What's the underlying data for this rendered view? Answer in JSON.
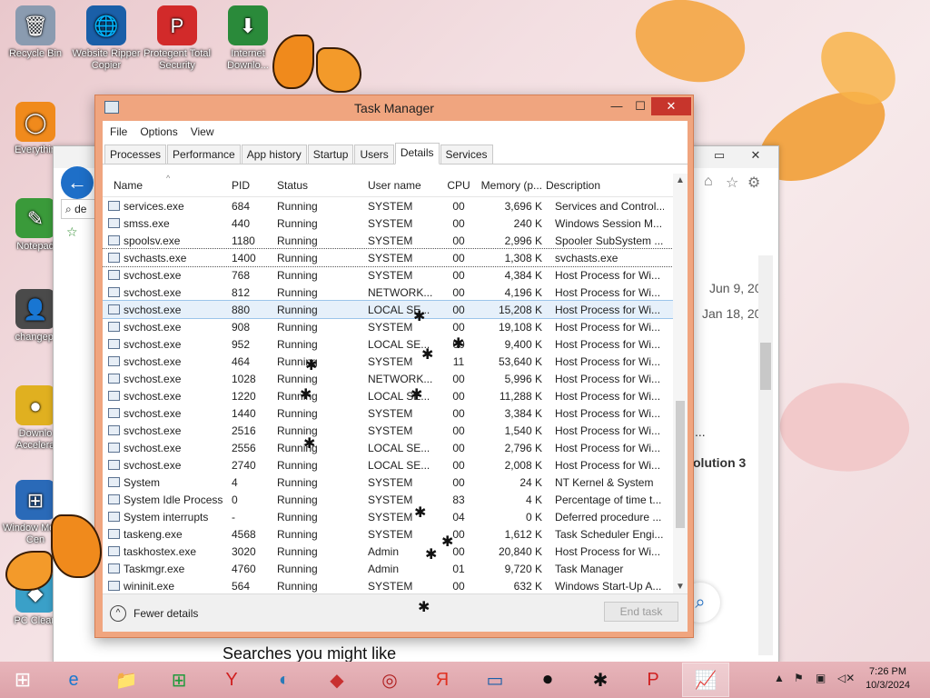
{
  "desktop_icons": [
    {
      "label": "Recycle Bin",
      "icon": "recycle-bin-icon",
      "glyph": "🗑"
    },
    {
      "label": "Website Ripper Copier",
      "icon": "globe-icon",
      "glyph": "🌐"
    },
    {
      "label": "Protegent Total Security",
      "icon": "shield-icon",
      "glyph": "P"
    },
    {
      "label": "Internet Downlo...",
      "icon": "download-icon",
      "glyph": "⬇"
    },
    {
      "label": "Everythin",
      "icon": "search-icon",
      "glyph": "◯"
    },
    {
      "label": "Notepad",
      "icon": "notepad-icon",
      "glyph": "✎"
    },
    {
      "label": "changepi",
      "icon": "user-icon",
      "glyph": "👤"
    },
    {
      "label": "Downlo Accelera",
      "icon": "download-accelerator-icon",
      "glyph": "●"
    },
    {
      "label": "Window Media Cen",
      "icon": "windows-media-icon",
      "glyph": "⊞"
    },
    {
      "label": "PC Clean",
      "icon": "pc-clean-icon",
      "glyph": "◆"
    }
  ],
  "browser": {
    "dates": [
      "Jun 9, 20",
      "Jan 18, 20"
    ],
    "ellipsis": "...",
    "solution": "olution 3",
    "searches": "Searches you might like",
    "search_prefix": "de"
  },
  "task_manager": {
    "title": "Task Manager",
    "menu": [
      "File",
      "Options",
      "View"
    ],
    "tabs": [
      "Processes",
      "Performance",
      "App history",
      "Startup",
      "Users",
      "Details",
      "Services"
    ],
    "active_tab": "Details",
    "columns": {
      "name": "Name",
      "pid": "PID",
      "status": "Status",
      "user": "User name",
      "cpu": "CPU",
      "mem": "Memory (p...",
      "desc": "Description"
    },
    "rows": [
      [
        "services.exe",
        "684",
        "Running",
        "SYSTEM",
        "00",
        "3,696 K",
        "Services and Control..."
      ],
      [
        "smss.exe",
        "440",
        "Running",
        "SYSTEM",
        "00",
        "240 K",
        "Windows Session M..."
      ],
      [
        "spoolsv.exe",
        "1180",
        "Running",
        "SYSTEM",
        "00",
        "2,996 K",
        "Spooler SubSystem ..."
      ],
      [
        "svchasts.exe",
        "1400",
        "Running",
        "SYSTEM",
        "00",
        "1,308 K",
        "svchasts.exe"
      ],
      [
        "svchost.exe",
        "768",
        "Running",
        "SYSTEM",
        "00",
        "4,384 K",
        "Host Process for Wi..."
      ],
      [
        "svchost.exe",
        "812",
        "Running",
        "NETWORK...",
        "00",
        "4,196 K",
        "Host Process for Wi..."
      ],
      [
        "svchost.exe",
        "880",
        "Running",
        "LOCAL SE...",
        "00",
        "15,208 K",
        "Host Process for Wi..."
      ],
      [
        "svchost.exe",
        "908",
        "Running",
        "SYSTEM",
        "00",
        "19,108 K",
        "Host Process for Wi..."
      ],
      [
        "svchost.exe",
        "952",
        "Running",
        "LOCAL SE...",
        "00",
        "9,400 K",
        "Host Process for Wi..."
      ],
      [
        "svchost.exe",
        "464",
        "Running",
        "SYSTEM",
        "11",
        "53,640 K",
        "Host Process for Wi..."
      ],
      [
        "svchost.exe",
        "1028",
        "Running",
        "NETWORK...",
        "00",
        "5,996 K",
        "Host Process for Wi..."
      ],
      [
        "svchost.exe",
        "1220",
        "Running",
        "LOCAL SE...",
        "00",
        "11,288 K",
        "Host Process for Wi..."
      ],
      [
        "svchost.exe",
        "1440",
        "Running",
        "SYSTEM",
        "00",
        "3,384 K",
        "Host Process for Wi..."
      ],
      [
        "svchost.exe",
        "2516",
        "Running",
        "SYSTEM",
        "00",
        "1,540 K",
        "Host Process for Wi..."
      ],
      [
        "svchost.exe",
        "2556",
        "Running",
        "LOCAL SE...",
        "00",
        "2,796 K",
        "Host Process for Wi..."
      ],
      [
        "svchost.exe",
        "2740",
        "Running",
        "LOCAL SE...",
        "00",
        "2,008 K",
        "Host Process for Wi..."
      ],
      [
        "System",
        "4",
        "Running",
        "SYSTEM",
        "00",
        "24 K",
        "NT Kernel & System"
      ],
      [
        "System Idle Process",
        "0",
        "Running",
        "SYSTEM",
        "83",
        "4 K",
        "Percentage of time t..."
      ],
      [
        "System interrupts",
        "-",
        "Running",
        "SYSTEM",
        "04",
        "0 K",
        "Deferred procedure ..."
      ],
      [
        "taskeng.exe",
        "4568",
        "Running",
        "SYSTEM",
        "00",
        "1,612 K",
        "Task Scheduler Engi..."
      ],
      [
        "taskhostex.exe",
        "3020",
        "Running",
        "Admin",
        "00",
        "20,840 K",
        "Host Process for Wi..."
      ],
      [
        "Taskmgr.exe",
        "4760",
        "Running",
        "Admin",
        "01",
        "9,720 K",
        "Task Manager"
      ],
      [
        "wininit.exe",
        "564",
        "Running",
        "SYSTEM",
        "00",
        "632 K",
        "Windows Start-Up A..."
      ]
    ],
    "focused_row": 3,
    "selected_row": 6,
    "fewer_details": "Fewer details",
    "end_task": "End task"
  },
  "taskbar": {
    "apps": [
      {
        "icon": "internet-explorer-icon",
        "glyph": "e"
      },
      {
        "icon": "file-explorer-icon",
        "glyph": "📁"
      },
      {
        "icon": "store-icon",
        "glyph": "⊞"
      },
      {
        "icon": "yandex-browser-icon",
        "glyph": "Y"
      },
      {
        "icon": "browser-icon",
        "glyph": "◐"
      },
      {
        "icon": "app-red-icon",
        "glyph": "◆"
      },
      {
        "icon": "app-circle-icon",
        "glyph": "◎"
      },
      {
        "icon": "yandex-icon",
        "glyph": "Я"
      },
      {
        "icon": "window-icon",
        "glyph": "▭"
      },
      {
        "icon": "record-icon",
        "glyph": "⏺"
      },
      {
        "icon": "ant-icon",
        "glyph": "✱"
      },
      {
        "icon": "protegent-icon",
        "glyph": "P"
      },
      {
        "icon": "task-manager-icon",
        "glyph": "📈"
      }
    ],
    "time": "7:26 PM",
    "date": "10/3/2024"
  }
}
